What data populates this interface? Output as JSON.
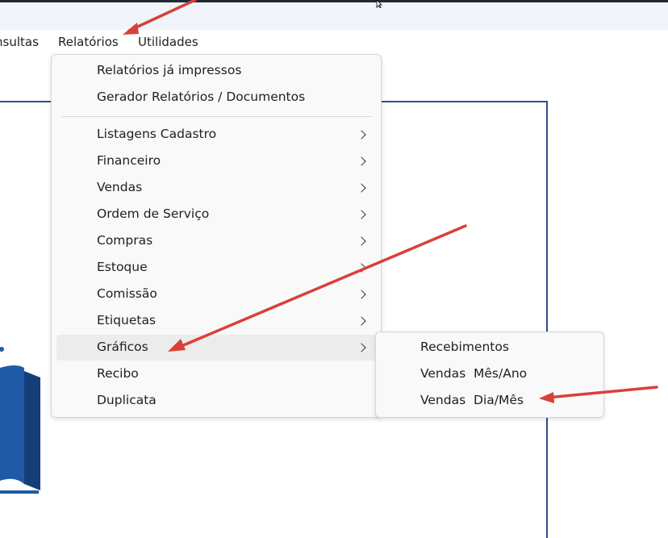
{
  "menubar": {
    "items": [
      {
        "label": "nsultas"
      },
      {
        "label": "Relatórios"
      },
      {
        "label": "Utilidades"
      }
    ]
  },
  "menu": {
    "items": [
      {
        "label": "Relatórios já impressos",
        "submenu": false
      },
      {
        "label": "Gerador Relatórios / Documentos",
        "submenu": false
      },
      {
        "label": "Listagens Cadastro",
        "submenu": true
      },
      {
        "label": "Financeiro",
        "submenu": true
      },
      {
        "label": "Vendas",
        "submenu": true
      },
      {
        "label": "Ordem de Serviço",
        "submenu": true
      },
      {
        "label": "Compras",
        "submenu": true
      },
      {
        "label": "Estoque",
        "submenu": true
      },
      {
        "label": "Comissão",
        "submenu": true
      },
      {
        "label": "Etiquetas",
        "submenu": true
      },
      {
        "label": "Gráficos",
        "submenu": true,
        "highlighted": true
      },
      {
        "label": "Recibo",
        "submenu": false
      },
      {
        "label": "Duplicata",
        "submenu": false
      }
    ]
  },
  "submenu": {
    "items": [
      {
        "label": "Recebimentos"
      },
      {
        "label": "Vendas  Mês/Ano"
      },
      {
        "label": "Vendas  Dia/Mês"
      }
    ]
  },
  "colors": {
    "annotation_arrow": "#d9403a",
    "frame_border": "#2a4d8f",
    "logo_blue": "#1f5aa6"
  }
}
